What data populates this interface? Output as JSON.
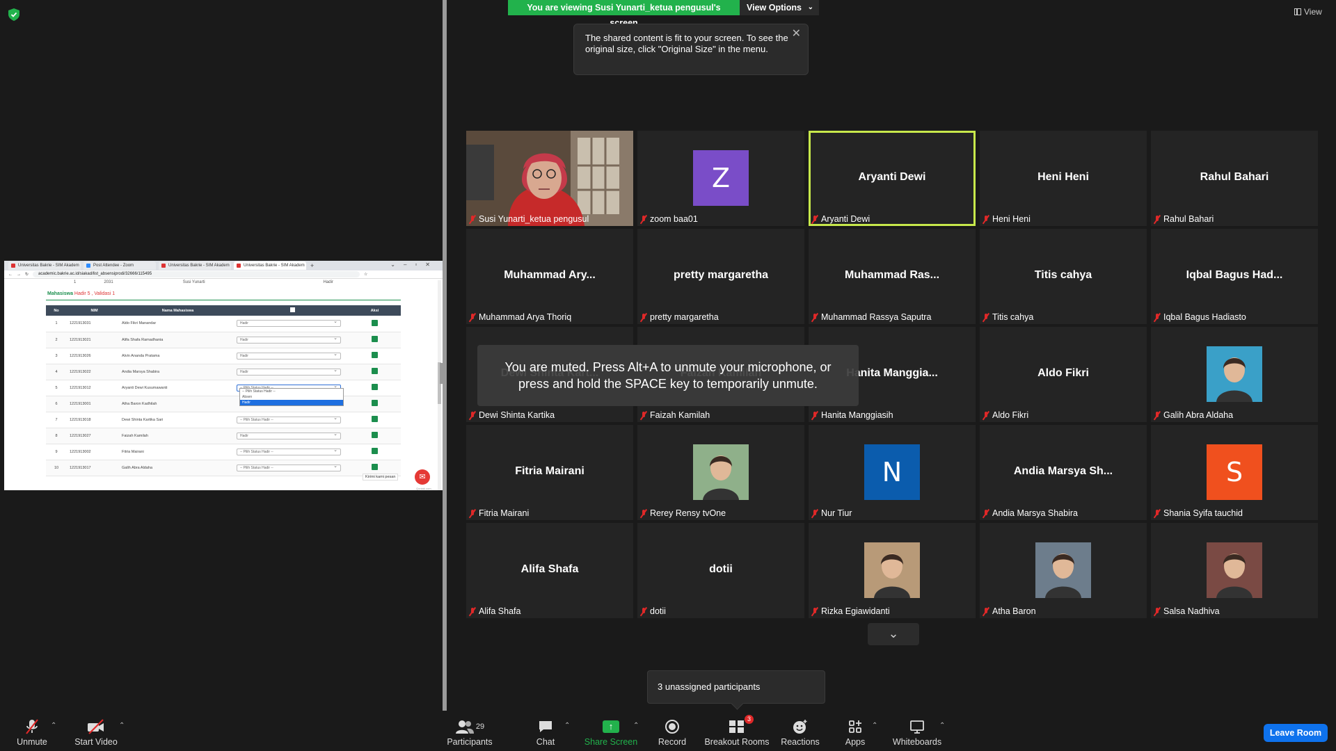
{
  "banner": {
    "viewing_text": "You are viewing Susi Yunarti_ketua pengusul's screen",
    "view_options_label": "View Options"
  },
  "tooltip": {
    "text": "The shared content is fit to your screen. To see the original size, click \"Original Size\" in the menu."
  },
  "top_right": {
    "view_label": "View"
  },
  "muted_toast": {
    "line1": "You are muted. Press Alt+A to unmute your microphone, or",
    "line2": "press and hold the SPACE key to temporarily unmute."
  },
  "unassigned": {
    "text": "3 unassigned participants"
  },
  "participants": [
    {
      "name": "Susi Yunarti_ketua pengusul",
      "display": "",
      "type": "video"
    },
    {
      "name": "zoom baa01",
      "display": "Z",
      "type": "letter",
      "color": "#7a4dc8"
    },
    {
      "name": "Aryanti Dewi",
      "display": "Aryanti Dewi",
      "type": "name",
      "active": true
    },
    {
      "name": "Heni Heni",
      "display": "Heni Heni",
      "type": "name"
    },
    {
      "name": "Rahul Bahari",
      "display": "Rahul Bahari",
      "type": "name"
    },
    {
      "name": "Muhammad Arya Thoriq",
      "display": "Muhammad Ary...",
      "type": "name"
    },
    {
      "name": "pretty margaretha",
      "display": "pretty margaretha",
      "type": "name"
    },
    {
      "name": "Muhammad Rassya Saputra",
      "display": "Muhammad Ras...",
      "type": "name"
    },
    {
      "name": "Titis cahya",
      "display": "Titis cahya",
      "type": "name"
    },
    {
      "name": "Iqbal Bagus Hadiasto",
      "display": "Iqbal Bagus Had...",
      "type": "name"
    },
    {
      "name": "Dewi Shinta Kartika",
      "display": "Dewi Shinta Kart...",
      "type": "name"
    },
    {
      "name": "Faizah Kamilah",
      "display": "Faizah Kamilah",
      "type": "name"
    },
    {
      "name": "Hanita Manggiasih",
      "display": "Hanita Manggia...",
      "type": "name"
    },
    {
      "name": "Aldo Fikri",
      "display": "Aldo Fikri",
      "type": "name"
    },
    {
      "name": "Galih Abra Aldaha",
      "display": "",
      "type": "photo",
      "color": "#3aa0c8"
    },
    {
      "name": "Fitria Mairani",
      "display": "Fitria Mairani",
      "type": "name"
    },
    {
      "name": "Rerey Rensy tvOne",
      "display": "",
      "type": "photo",
      "color": "#8fb08a"
    },
    {
      "name": "Nur Tiur",
      "display": "N",
      "type": "letter",
      "color": "#0b5cad"
    },
    {
      "name": "Andia Marsya Shabira",
      "display": "Andia Marsya Sh...",
      "type": "name"
    },
    {
      "name": "Shania Syifa tauchid",
      "display": "S",
      "type": "letter",
      "color": "#f0501e"
    },
    {
      "name": "Alifa Shafa",
      "display": "Alifa Shafa",
      "type": "name"
    },
    {
      "name": "dotii",
      "display": "dotii",
      "type": "name"
    },
    {
      "name": "Rizka Egiawidanti",
      "display": "",
      "type": "photo",
      "color": "#b89a78"
    },
    {
      "name": "Atha Baron",
      "display": "",
      "type": "photo",
      "color": "#6d7d8c"
    },
    {
      "name": "Salsa Nadhiva",
      "display": "",
      "type": "photo",
      "color": "#7a4a44"
    }
  ],
  "shared_browser": {
    "tabs": [
      "Universitas Bakrie - SIM Akadem",
      "Post Attendee - Zoom",
      "Universitas Bakrie - SIM Akadem",
      "Universitas Bakrie - SIM Akadem"
    ],
    "url": "academic.bakrie.ac.id/siakad/list_absensiprodi/32666/115495",
    "top_row": [
      "1",
      "2031",
      "Susi Yunarti",
      "Hadir"
    ],
    "section_title": "Mahasiswa",
    "section_counts": "Hadir 5 , Validasi 1",
    "table_headers": [
      "No",
      "NIM",
      "Nama Mahasiswa",
      "",
      "Aksi"
    ],
    "rows": [
      {
        "no": "1",
        "nim": "1221913031",
        "nama": "Aldo Fikri Manandar",
        "status": "Hadir"
      },
      {
        "no": "2",
        "nim": "1221913021",
        "nama": "Alifa Shafa Ramadhania",
        "status": "Hadir"
      },
      {
        "no": "3",
        "nim": "1221913026",
        "nama": "Alvin Ananda Pratama",
        "status": "Hadir"
      },
      {
        "no": "4",
        "nim": "1221913022",
        "nama": "Andia Marsya Shabira",
        "status": "Hadir"
      },
      {
        "no": "5",
        "nim": "1221913012",
        "nama": "Aryanti Dewi Kusumawanti",
        "status": "-- Pilih Status Hadir --"
      },
      {
        "no": "6",
        "nim": "1221913001",
        "nama": "Atha Baron Kadhilah",
        "status": ""
      },
      {
        "no": "7",
        "nim": "1221913018",
        "nama": "Dewi Shinta Kartika Sari",
        "status": "-- Pilih Status Hadir --"
      },
      {
        "no": "8",
        "nim": "1221913027",
        "nama": "Faizah Kamilah",
        "status": "Hadir"
      },
      {
        "no": "9",
        "nim": "1221913002",
        "nama": "Fitria Mairani",
        "status": "-- Pilih Status Hadir --"
      },
      {
        "no": "10",
        "nim": "1221913017",
        "nama": "Galih Abra Aldaha",
        "status": "-- Pilih Status Hadir --"
      }
    ],
    "dropdown_options": [
      "-- Pilih Status Hadir --",
      "Absen",
      "Hadir"
    ],
    "chat_hint": "Kirimi kami pesan",
    "powered": "Qontak.com"
  },
  "toolbar": {
    "unmute": "Unmute",
    "start_video": "Start Video",
    "participants": "Participants",
    "participants_count": "29",
    "chat": "Chat",
    "share_screen": "Share Screen",
    "record": "Record",
    "breakout_rooms": "Breakout Rooms",
    "breakout_badge": "3",
    "reactions": "Reactions",
    "apps": "Apps",
    "whiteboards": "Whiteboards",
    "leave_room": "Leave Room"
  },
  "colors": {
    "accent_green": "#22b24c",
    "active_speaker": "#c7e84b",
    "leave_blue": "#0e72ed",
    "muted_red": "#e02828"
  }
}
